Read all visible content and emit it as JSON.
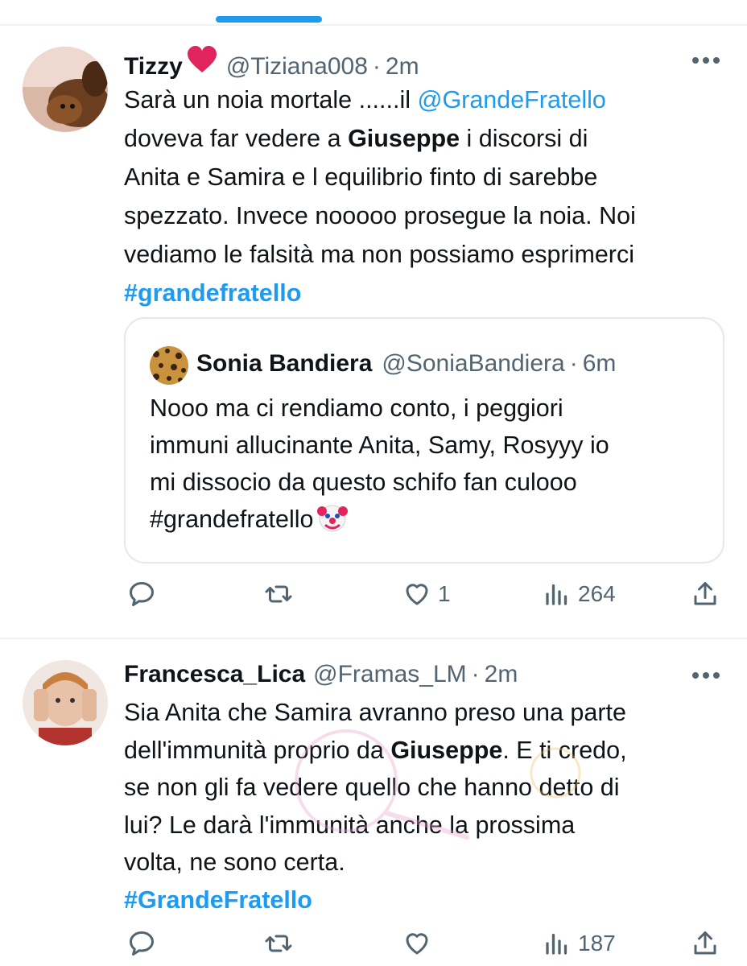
{
  "tweets": [
    {
      "name": "Tizzy",
      "handle": "@Tiziana008",
      "time": "2m",
      "text": {
        "l1a": "Sarà un noia mortale ......il ",
        "mention": "@GrandeFratello",
        "l2a": "doveva far vedere a ",
        "bold": "Giuseppe",
        "l2b": " i discorsi di",
        "l3": "Anita e Samira e l equilibrio finto di sarebbe",
        "l4": "spezzato. Invece nooooo prosegue la noia. Noi",
        "l5": "vediamo le falsità ma non possiamo esprimerci",
        "hashtag": "#grandefratello"
      },
      "quote": {
        "name": "Sonia Bandiera",
        "handle": "@SoniaBandiera",
        "time": "6m",
        "lines": [
          "Nooo ma ci rendiamo conto, i peggiori",
          "immuni allucinante Anita, Samy, Rosyyy io",
          "mi dissocio da questo schifo fan culooo",
          "#grandefratello"
        ]
      },
      "actions": {
        "reply": "",
        "retweet": "",
        "like": "1",
        "views": "264"
      }
    },
    {
      "name": "Francesca_Lica",
      "handle": "@Framas_LM",
      "time": "2m",
      "text": {
        "l1": "Sia Anita che Samira avranno preso una parte",
        "l2a": "dell'immunità proprio da ",
        "bold": "Giuseppe",
        "l2b": ". E ti credo,",
        "l3": "se non gli fa vedere quello che hanno detto di",
        "l4": "lui? Le darà l'immunità anche la prossima",
        "l5": "volta, ne sono certa.",
        "hashtag": "#GrandeFratello"
      },
      "actions": {
        "reply": "",
        "retweet": "",
        "like": "",
        "views": "187"
      }
    }
  ],
  "colors": {
    "accent": "#1d9bf0",
    "secondary_text": "#536471",
    "heart": "#e0245e"
  },
  "icons": [
    "more-icon",
    "reply-icon",
    "retweet-icon",
    "like-icon",
    "views-icon",
    "share-icon",
    "heart-emoji",
    "clown-emoji"
  ]
}
